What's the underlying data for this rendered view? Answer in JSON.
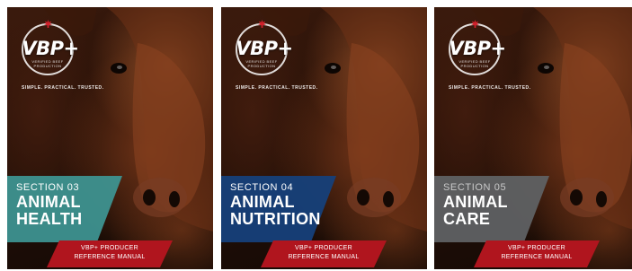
{
  "covers": [
    {
      "brand": "VBP+",
      "seal_text": "VERIFIED BEEF PRODUCTION",
      "tagline": "SIMPLE. PRACTICAL. TRUSTED.",
      "section": "SECTION 03",
      "title_line1": "ANIMAL",
      "title_line2": "HEALTH",
      "manual_line1": "VBP+ PRODUCER",
      "manual_line2": "REFERENCE MANUAL",
      "band_color": "#3e9492"
    },
    {
      "brand": "VBP+",
      "seal_text": "VERIFIED BEEF PRODUCTION",
      "tagline": "SIMPLE. PRACTICAL. TRUSTED.",
      "section": "SECTION 04",
      "title_line1": "ANIMAL",
      "title_line2": "NUTRITION",
      "manual_line1": "VBP+ PRODUCER",
      "manual_line2": "REFERENCE MANUAL",
      "band_color": "#16407a"
    },
    {
      "brand": "VBP+",
      "seal_text": "VERIFIED BEEF PRODUCTION",
      "tagline": "SIMPLE. PRACTICAL. TRUSTED.",
      "section": "SECTION 05",
      "title_line1": "ANIMAL",
      "title_line2": "CARE",
      "manual_line1": "VBP+ PRODUCER",
      "manual_line2": "REFERENCE MANUAL",
      "band_color": "#5f6163"
    }
  ],
  "icons": {
    "leaf": "maple-leaf-icon",
    "cow": "cow-photo"
  },
  "colors": {
    "manual_band": "#b0151e",
    "maple_leaf": "#d0202a"
  }
}
